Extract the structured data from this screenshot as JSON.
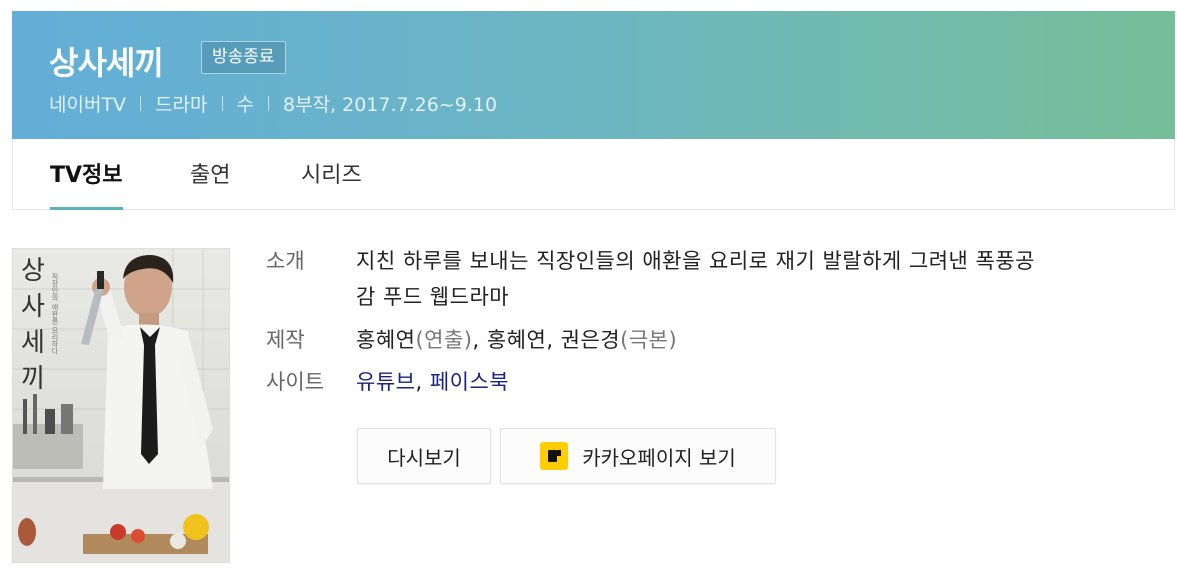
{
  "header": {
    "title": "상사세끼",
    "badge": "방송종료",
    "meta": [
      "네이버TV",
      "드라마",
      "수",
      "8부작, 2017.7.26~9.10"
    ],
    "gradient": [
      "#62aed8",
      "#76be98"
    ]
  },
  "tabs": [
    {
      "label": "TV정보",
      "active": true
    },
    {
      "label": "출연",
      "active": false
    },
    {
      "label": "시리즈",
      "active": false
    }
  ],
  "poster": {
    "title_vertical": "상사세끼",
    "subtitle_vertical": "직장인의 애환을 요리하다"
  },
  "info": {
    "intro_label": "소개",
    "intro_line1": "지친 하루를 보내는 직장인들의 애환을 요리로 재기 발랄하게 그려낸 폭풍공",
    "intro_line2": "감 푸드 웹드라마",
    "production_label": "제작",
    "production": {
      "director": "홍혜연",
      "director_role": "(연출)",
      "writers": "홍혜연, 권은경",
      "writers_role": "(극본)"
    },
    "site_label": "사이트",
    "sites": [
      "유튜브",
      "페이스북"
    ]
  },
  "buttons": {
    "rewatch": "다시보기",
    "kakaopage": "카카오페이지 보기"
  }
}
